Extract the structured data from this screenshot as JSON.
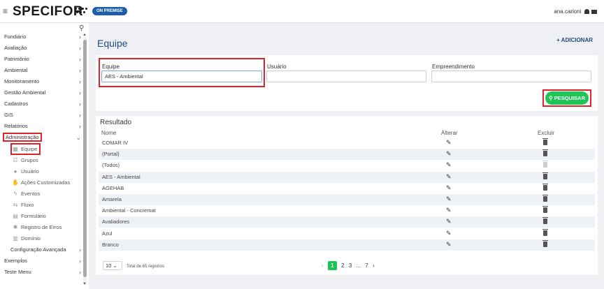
{
  "header": {
    "brand": "SPECIFOR",
    "badge": "ON PREMISE",
    "user": "ana.carioni"
  },
  "sidebar": {
    "items": [
      {
        "label": "Fundiário"
      },
      {
        "label": "Avaliação"
      },
      {
        "label": "Patrimônio"
      },
      {
        "label": "Ambiental"
      },
      {
        "label": "Monitoramento"
      },
      {
        "label": "Gestão Ambiental"
      },
      {
        "label": "Cadastros"
      },
      {
        "label": "GIS"
      },
      {
        "label": "Relatórios"
      },
      {
        "label": "Administração"
      }
    ],
    "sub_items": [
      {
        "label": "Equipe",
        "icon": "team-icon"
      },
      {
        "label": "Grupos",
        "icon": "group-icon"
      },
      {
        "label": "Usuário",
        "icon": "user-icon"
      },
      {
        "label": "Ações Customizadas",
        "icon": "custom-action-icon"
      },
      {
        "label": "Eventos",
        "icon": "bolt-icon"
      },
      {
        "label": "Fluxo",
        "icon": "flow-icon"
      },
      {
        "label": "Formulário",
        "icon": "form-icon"
      },
      {
        "label": "Registro de Erros",
        "icon": "bug-icon"
      },
      {
        "label": "Domínio",
        "icon": "domain-icon"
      }
    ],
    "advanced": "Configuração Avançada",
    "bottom_items": [
      {
        "label": "Exemplos"
      },
      {
        "label": "Teste Menu"
      }
    ]
  },
  "main": {
    "title": "Equipe",
    "add_label": "+ ADICIONAR",
    "filters": {
      "equipe_label": "Equipe",
      "equipe_value": "AES - Ambiental",
      "usuario_label": "Usuário",
      "usuario_value": "",
      "empreendimento_label": "Empreendimento",
      "empreendimento_value": ""
    },
    "search_label": "PESQUISAR",
    "results": {
      "title": "Resultado",
      "col_name": "Nome",
      "col_edit": "Alterar",
      "col_delete": "Excluir",
      "rows": [
        {
          "name": "COMAR IV",
          "delete_enabled": true
        },
        {
          "name": "(Portal)",
          "delete_enabled": true
        },
        {
          "name": "(Todos)",
          "delete_enabled": false
        },
        {
          "name": "AES - Ambiental",
          "delete_enabled": true
        },
        {
          "name": "AGEHAB",
          "delete_enabled": true
        },
        {
          "name": "Amarela",
          "delete_enabled": true
        },
        {
          "name": "Ambiental - Concremat",
          "delete_enabled": true
        },
        {
          "name": "Avaliadores",
          "delete_enabled": true
        },
        {
          "name": "Azul",
          "delete_enabled": true
        },
        {
          "name": "Branco",
          "delete_enabled": true
        }
      ]
    },
    "pagination": {
      "page_size": "10",
      "total_text": "Total de 65 registros",
      "pages": [
        "1",
        "2",
        "3",
        "...",
        "7"
      ],
      "current": "1",
      "prev": "‹",
      "next": "›"
    }
  },
  "colors": {
    "accent": "#224a7c",
    "success": "#1fc457",
    "highlight": "#d9252a"
  }
}
